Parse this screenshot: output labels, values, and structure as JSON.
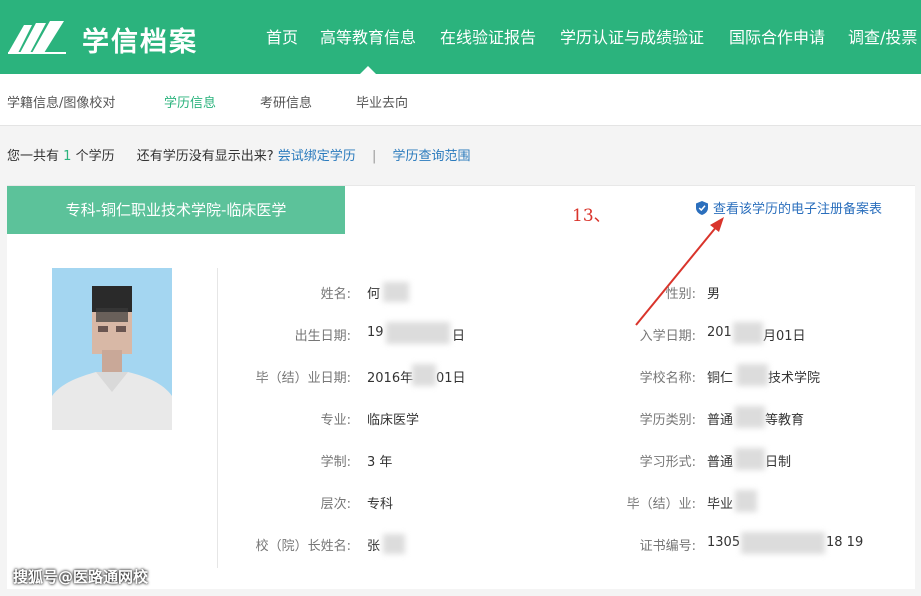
{
  "brand": {
    "name": "学信档案"
  },
  "colors": {
    "brand": "#2bb37d",
    "tab": "#5cc29a",
    "link": "#2b6fbd",
    "annotation": "#d9342b"
  },
  "nav": {
    "items": [
      {
        "label": "首页",
        "active": false
      },
      {
        "label": "高等教育信息",
        "active": true
      },
      {
        "label": "在线验证报告",
        "active": false
      },
      {
        "label": "学历认证与成绩验证",
        "active": false
      },
      {
        "label": "国际合作申请",
        "active": false
      },
      {
        "label": "调查/投票",
        "active": false
      }
    ]
  },
  "subnav": {
    "items": [
      {
        "label": "学籍信息/图像校对",
        "active": false
      },
      {
        "label": "学历信息",
        "active": true
      },
      {
        "label": "考研信息",
        "active": false
      },
      {
        "label": "毕业去向",
        "active": false
      }
    ]
  },
  "summary": {
    "prefix": "您一共有",
    "count": "1",
    "suffix": "个学历",
    "question": "还有学历没有显示出来?",
    "bind_link": "尝试绑定学历",
    "separator": "|",
    "range_link": "学历查询范围"
  },
  "record": {
    "tab_label": "专科-铜仁职业技术学院-临床医学",
    "registration_link": "查看该学历的电子注册备案表",
    "photo_icon": "student-photo",
    "left_fields": [
      {
        "label": "姓名:",
        "value": "何"
      },
      {
        "label": "出生日期:",
        "value": "19"
      },
      {
        "label": "毕（结）业日期:",
        "value": "2016年"
      },
      {
        "label": "专业:",
        "value": "临床医学"
      },
      {
        "label": "学制:",
        "value": "3 年"
      },
      {
        "label": "层次:",
        "value": "专科"
      },
      {
        "label": "校（院）长姓名:",
        "value": "张"
      }
    ],
    "left_values_after_blur": [
      "",
      "日",
      "01日",
      "",
      "",
      "",
      ""
    ],
    "right_fields": [
      {
        "label": "性别:",
        "value": "男"
      },
      {
        "label": "入学日期:",
        "value": "201"
      },
      {
        "label": "学校名称:",
        "value": "铜仁"
      },
      {
        "label": "学历类别:",
        "value": "普通"
      },
      {
        "label": "学习形式:",
        "value": "普通"
      },
      {
        "label": "毕（结）业:",
        "value": "毕业"
      },
      {
        "label": "证书编号:",
        "value": "1305"
      }
    ],
    "right_values_after_blur": [
      "",
      "月01日",
      "技术学院",
      "等教育",
      "日制",
      "",
      "18  19"
    ]
  },
  "annotation": {
    "number": "13、"
  },
  "watermark": {
    "text": "搜狐号@医路通网校"
  }
}
